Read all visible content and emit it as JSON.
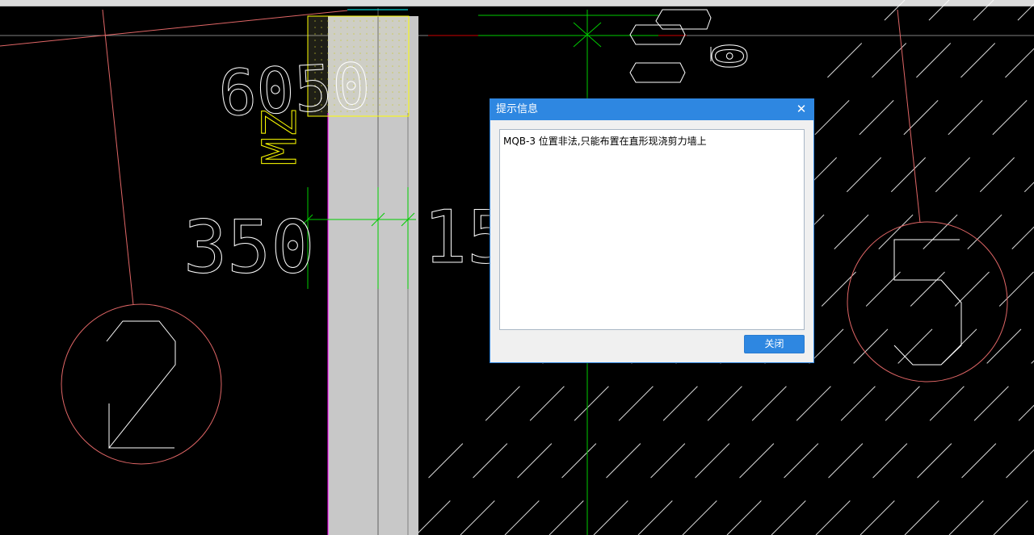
{
  "dialog": {
    "title": "提示信息",
    "close_icon": "close-icon",
    "close_glyph": "✕",
    "message": "MQB-3 位置非法,只能布置在直形现浇剪力墙上",
    "close_button_label": "关闭"
  },
  "drawing": {
    "dimension_labels": [
      "6050",
      "350",
      "15",
      "0"
    ],
    "component_label": "MZ",
    "axis_markers": [
      "2",
      "5"
    ],
    "colors": {
      "background": "#000000",
      "axis": "#e06666",
      "dimension": "#00cc00",
      "text": "#ffffff",
      "wall_fill": "#c8c8c8",
      "highlight": "#ffff00",
      "wall_edge": "#ff00ff",
      "dialog_accent": "#2e87e1"
    }
  }
}
